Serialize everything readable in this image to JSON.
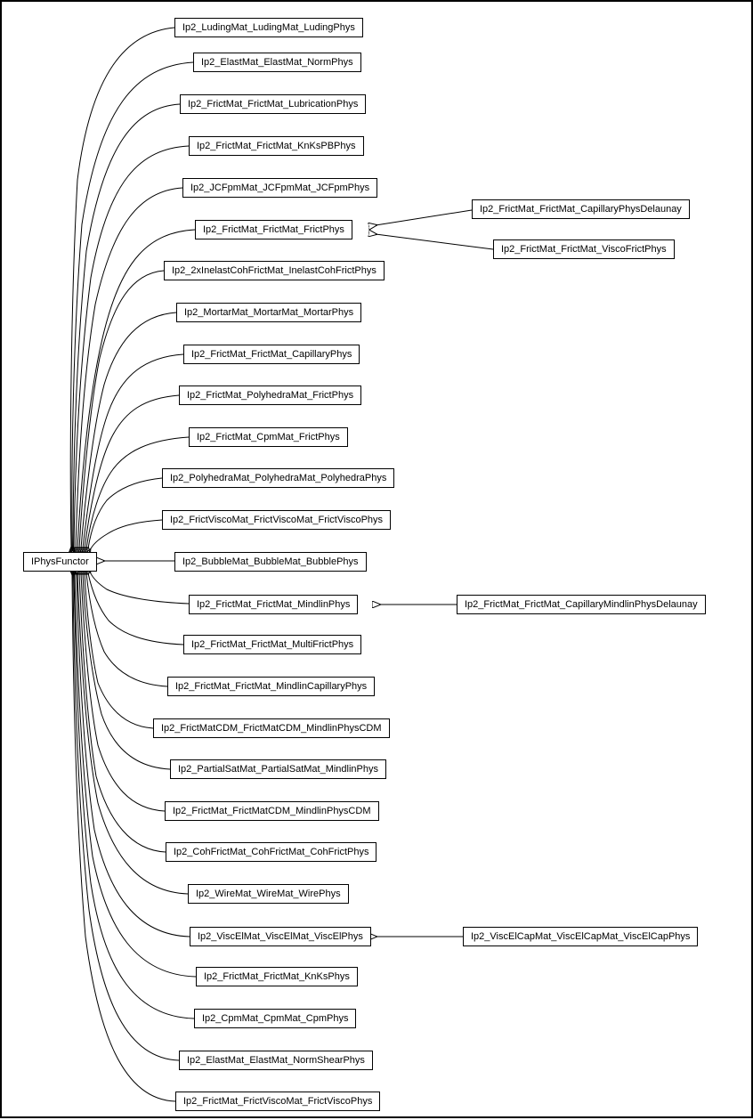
{
  "root": {
    "label": "IPhysFunctor"
  },
  "children": [
    {
      "key": "n0",
      "label": "Ip2_LudingMat_LudingMat_LudingPhys"
    },
    {
      "key": "n1",
      "label": "Ip2_ElastMat_ElastMat_NormPhys"
    },
    {
      "key": "n2",
      "label": "Ip2_FrictMat_FrictMat_LubricationPhys"
    },
    {
      "key": "n3",
      "label": "Ip2_FrictMat_FrictMat_KnKsPBPhys"
    },
    {
      "key": "n4",
      "label": "Ip2_JCFpmMat_JCFpmMat_JCFpmPhys"
    },
    {
      "key": "n5",
      "label": "Ip2_FrictMat_FrictMat_FrictPhys"
    },
    {
      "key": "n6",
      "label": "Ip2_2xInelastCohFrictMat_InelastCohFrictPhys"
    },
    {
      "key": "n7",
      "label": "Ip2_MortarMat_MortarMat_MortarPhys"
    },
    {
      "key": "n8",
      "label": "Ip2_FrictMat_FrictMat_CapillaryPhys"
    },
    {
      "key": "n9",
      "label": "Ip2_FrictMat_PolyhedraMat_FrictPhys"
    },
    {
      "key": "n10",
      "label": "Ip2_FrictMat_CpmMat_FrictPhys"
    },
    {
      "key": "n11",
      "label": "Ip2_PolyhedraMat_PolyhedraMat_PolyhedraPhys"
    },
    {
      "key": "n12",
      "label": "Ip2_FrictViscoMat_FrictViscoMat_FrictViscoPhys"
    },
    {
      "key": "n13",
      "label": "Ip2_BubbleMat_BubbleMat_BubblePhys"
    },
    {
      "key": "n14",
      "label": "Ip2_FrictMat_FrictMat_MindlinPhys"
    },
    {
      "key": "n15",
      "label": "Ip2_FrictMat_FrictMat_MultiFrictPhys"
    },
    {
      "key": "n16",
      "label": "Ip2_FrictMat_FrictMat_MindlinCapillaryPhys"
    },
    {
      "key": "n17",
      "label": "Ip2_FrictMatCDM_FrictMatCDM_MindlinPhysCDM"
    },
    {
      "key": "n18",
      "label": "Ip2_PartialSatMat_PartialSatMat_MindlinPhys"
    },
    {
      "key": "n19",
      "label": "Ip2_FrictMat_FrictMatCDM_MindlinPhysCDM"
    },
    {
      "key": "n20",
      "label": "Ip2_CohFrictMat_CohFrictMat_CohFrictPhys"
    },
    {
      "key": "n21",
      "label": "Ip2_WireMat_WireMat_WirePhys"
    },
    {
      "key": "n22",
      "label": "Ip2_ViscElMat_ViscElMat_ViscElPhys"
    },
    {
      "key": "n23",
      "label": "Ip2_FrictMat_FrictMat_KnKsPhys"
    },
    {
      "key": "n24",
      "label": "Ip2_CpmMat_CpmMat_CpmPhys"
    },
    {
      "key": "n25",
      "label": "Ip2_ElastMat_ElastMat_NormShearPhys"
    },
    {
      "key": "n26",
      "label": "Ip2_FrictMat_FrictViscoMat_FrictViscoPhys"
    }
  ],
  "grandchildren": {
    "g5a": {
      "label": "Ip2_FrictMat_FrictMat_CapillaryPhysDelaunay"
    },
    "g5b": {
      "label": "Ip2_FrictMat_FrictMat_ViscoFrictPhys"
    },
    "g14": {
      "label": "Ip2_FrictMat_FrictMat_CapillaryMindlinPhysDelaunay"
    },
    "g22": {
      "label": "Ip2_ViscElCapMat_ViscElCapMat_ViscElCapPhys"
    }
  }
}
